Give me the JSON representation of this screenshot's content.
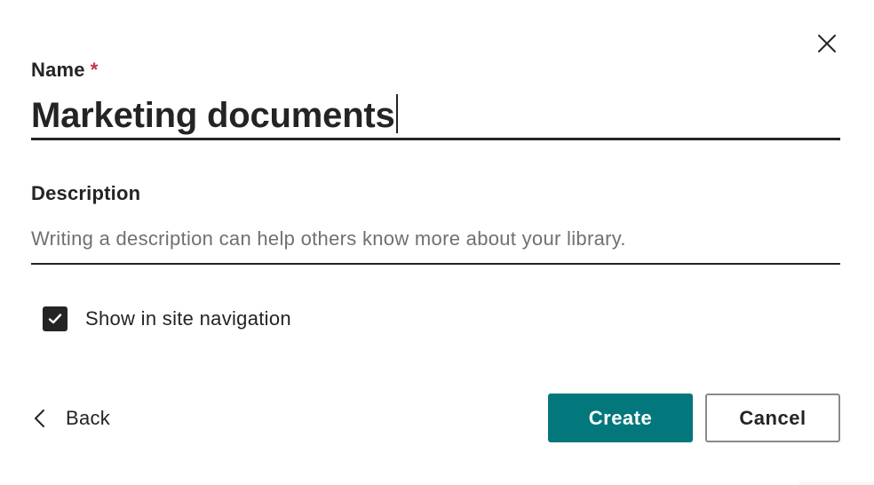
{
  "dialog": {
    "close_icon": "close-icon",
    "name": {
      "label": "Name",
      "required_mark": "*",
      "value": "Marketing documents"
    },
    "description": {
      "label": "Description",
      "placeholder": "Writing a description can help others know more about your library.",
      "value": ""
    },
    "show_in_nav": {
      "label": "Show in site navigation",
      "checked": true
    },
    "back": {
      "icon": "chevron-left-icon",
      "label": "Back"
    },
    "create_label": "Create",
    "cancel_label": "Cancel"
  },
  "colors": {
    "primary": "#03787c",
    "required": "#c4314b",
    "text": "#242424",
    "placeholder": "#707070"
  }
}
